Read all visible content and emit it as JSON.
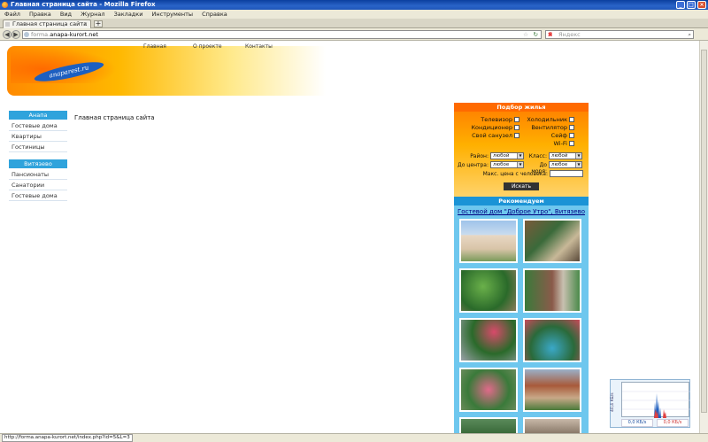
{
  "window": {
    "title": "Главная страница сайта - Mozilla Firefox"
  },
  "menubar": [
    "Файл",
    "Правка",
    "Вид",
    "Журнал",
    "Закладки",
    "Инструменты",
    "Справка"
  ],
  "tab": {
    "title": "Главная страница сайта",
    "new_tab": "+"
  },
  "navbar": {
    "back": "◀",
    "forward": "▶",
    "url_scheme": "forma.",
    "url_domain": "anapa-kurort.net",
    "search_placeholder": "Яндекс",
    "search_engine_letter": "Я"
  },
  "header": {
    "logo_text": "anaparest.ru",
    "nav": [
      "Главная",
      "О проекте",
      "Контакты"
    ]
  },
  "sidebar": {
    "sections": [
      {
        "title": "Анапа",
        "items": [
          "Гостевые дома",
          "Квартиры",
          "Гостиницы"
        ]
      },
      {
        "title": "Витязево",
        "items": [
          "Пансионаты",
          "Санатории",
          "Гостевые дома"
        ]
      }
    ]
  },
  "main": {
    "title": "Главная страница сайта"
  },
  "filter": {
    "title": "Подбор жилья",
    "amenities_left": [
      "Телевизор",
      "Кондиционер",
      "Свой санузел"
    ],
    "amenities_right": [
      "Холодильник",
      "Вентилятор",
      "Сейф",
      "Wi-Fi"
    ],
    "district_label": "Район:",
    "district_value": "любой",
    "class_label": "Класс:",
    "class_value": "любой",
    "center_label": "До центра:",
    "center_value": "любое",
    "sea_label": "До моря:",
    "sea_value": "любое",
    "price_label": "Макс. цена с человека:",
    "search_button": "Искать"
  },
  "recommended": {
    "title": "Рекомендуем",
    "link_text": "Гостевой дом \"Доброе Утро\", Витязево"
  },
  "netmon": {
    "axis_label": "40,4 КБ/s",
    "read": "0,0 КБ/s",
    "write": "0,0 КБ/s"
  },
  "status": {
    "text": "http://forma.anapa-kurort.net/index.php?id=5&L=3"
  }
}
